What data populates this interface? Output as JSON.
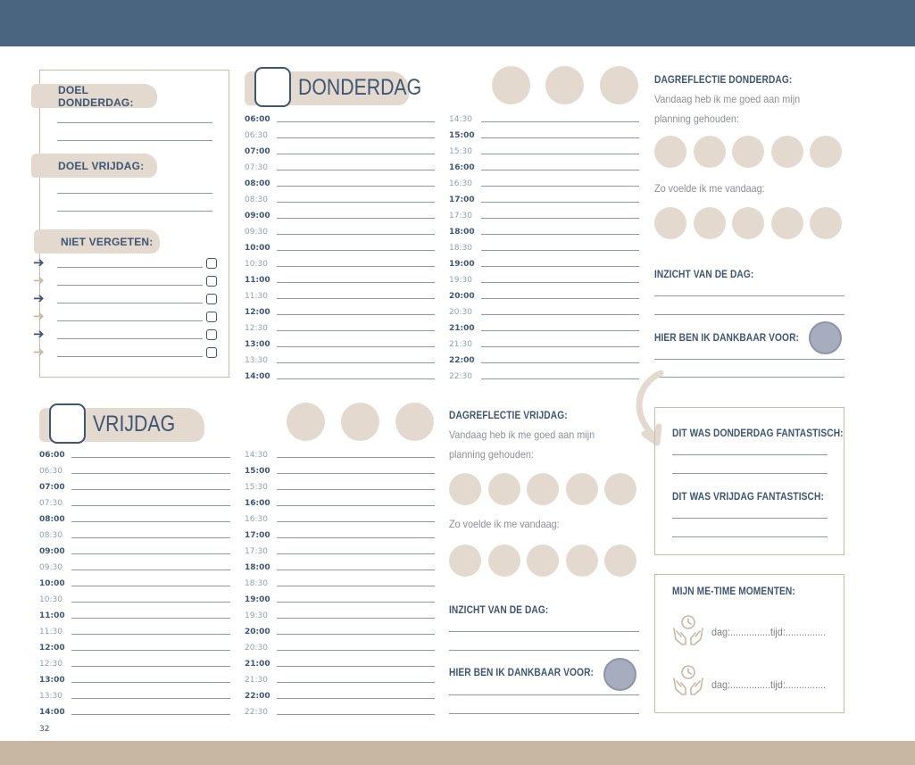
{
  "page_number": "32",
  "colors": {
    "navy": "#4a6580",
    "beige": "#e3d9cf",
    "sand": "#c8b8a3"
  },
  "sidebar": {
    "goal_thursday": "DOEL DONDERDAG:",
    "goal_friday": "DOEL VRIJDAG:",
    "dont_forget": "NIET VERGETEN:",
    "todo_arrow_colors": [
      "navy",
      "sand",
      "navy",
      "sand",
      "navy",
      "sand"
    ]
  },
  "thursday": {
    "title": "DONDERDAG",
    "times_left": [
      "06:00",
      "06:30",
      "07:00",
      "07:30",
      "08:00",
      "08:30",
      "09:00",
      "09:30",
      "10:00",
      "10:30",
      "11:00",
      "11:30",
      "12:00",
      "12:30",
      "13:00",
      "13:30",
      "14:00"
    ],
    "times_right": [
      "14:30",
      "15:00",
      "15:30",
      "16:00",
      "16:30",
      "17:00",
      "17:30",
      "18:00",
      "18:30",
      "19:00",
      "19:30",
      "20:00",
      "20:30",
      "21:00",
      "21:30",
      "22:00",
      "22:30"
    ],
    "reflection": {
      "title": "DAGREFLECTIE DONDERDAG:",
      "q1_line1": "Vandaag heb ik me goed aan mijn",
      "q1_line2": "planning gehouden:",
      "q2": "Zo voelde ik me vandaag:",
      "insight": "INZICHT VAN DE DAG:",
      "grateful": "HIER BEN IK DANKBAAR VOOR:"
    }
  },
  "friday": {
    "title": "VRIJDAG",
    "times_left": [
      "06:00",
      "06:30",
      "07:00",
      "07:30",
      "08:00",
      "08:30",
      "09:00",
      "09:30",
      "10:00",
      "10:30",
      "11:00",
      "11:30",
      "12:00",
      "12:30",
      "13:00",
      "13:30",
      "14:00"
    ],
    "times_right": [
      "14:30",
      "15:00",
      "15:30",
      "16:00",
      "16:30",
      "17:00",
      "17:30",
      "18:00",
      "18:30",
      "19:00",
      "19:30",
      "20:00",
      "20:30",
      "21:00",
      "21:30",
      "22:00",
      "22:30"
    ],
    "reflection": {
      "title": "DAGREFLECTIE VRIJDAG:",
      "q1_line1": "Vandaag heb ik me goed aan mijn",
      "q1_line2": "planning gehouden:",
      "q2": "Zo voelde ik me vandaag:",
      "insight": "INZICHT VAN DE DAG:",
      "grateful": "HIER BEN IK DANKBAAR VOOR:"
    }
  },
  "fantastic": {
    "thursday": "DIT WAS DONDERDAG FANTASTISCH:",
    "friday": "DIT WAS VRIJDAG FANTASTISCH:"
  },
  "metime": {
    "title": "MIJN ME-TIME MOMENTEN:",
    "row1": "dag:...............tijd:...............",
    "row2": "dag:...............tijd:..............."
  }
}
